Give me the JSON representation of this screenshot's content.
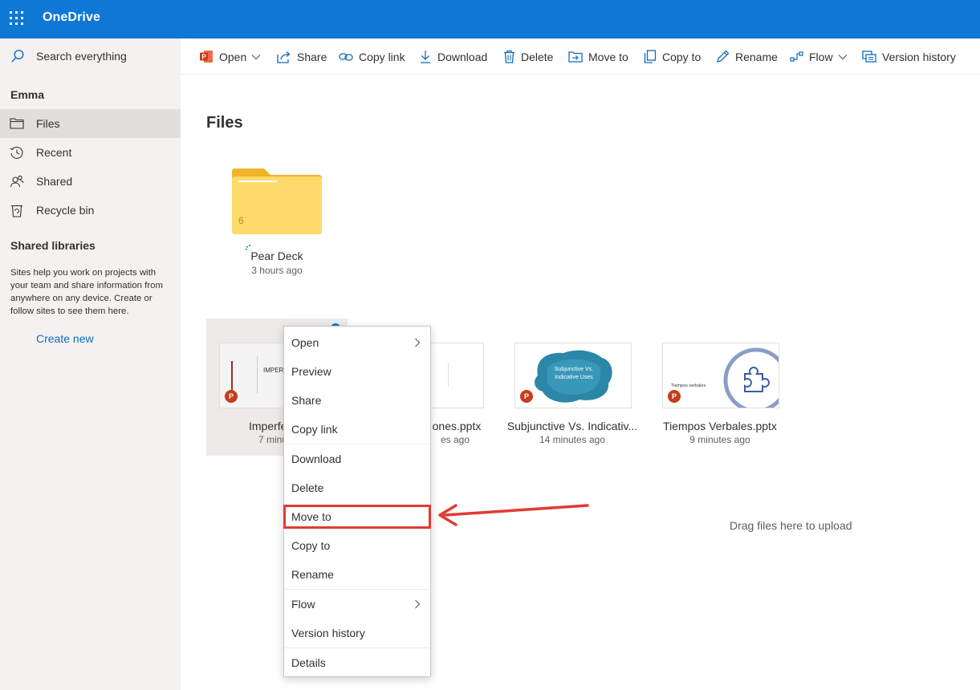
{
  "app": {
    "title": "OneDrive"
  },
  "search": {
    "placeholder": "Search everything"
  },
  "toolbar": {
    "open": "Open",
    "share": "Share",
    "copy_link": "Copy link",
    "download": "Download",
    "delete": "Delete",
    "move_to": "Move to",
    "copy_to": "Copy to",
    "rename": "Rename",
    "flow": "Flow",
    "version_history": "Version history"
  },
  "sidebar": {
    "user": "Emma",
    "items": [
      {
        "label": "Files",
        "icon": "folder-icon",
        "active": true
      },
      {
        "label": "Recent",
        "icon": "clock-icon"
      },
      {
        "label": "Shared",
        "icon": "people-icon"
      },
      {
        "label": "Recycle bin",
        "icon": "recycle-bin-icon"
      }
    ],
    "shared_libraries_title": "Shared libraries",
    "shared_libraries_desc": "Sites help you work on projects with your team and share information from anywhere on any device. Create or follow sites to see them here.",
    "create_new": "Create new"
  },
  "main": {
    "title": "Files",
    "folder": {
      "name": "Pear Deck",
      "modified": "3 hours ago",
      "count": "6"
    },
    "files": [
      {
        "name": "Imperfect u",
        "modified": "7 minute",
        "thumb_text": "IMPER TENS",
        "selected": true
      },
      {
        "name": "ones.pptx",
        "modified": "es ago"
      },
      {
        "name": "Subjunctive Vs. Indicativ...",
        "modified": "14 minutes ago",
        "thumb_text": "Subjunctive Vs. Indicative Uses"
      },
      {
        "name": "Tiempos Verbales.pptx",
        "modified": "9 minutes ago",
        "thumb_text": "Tiempos verbales"
      }
    ],
    "drag_hint": "Drag files here to upload"
  },
  "context_menu": {
    "items": [
      "Open",
      "Preview",
      "Share",
      "Copy link",
      "Download",
      "Delete",
      "Move to",
      "Copy to",
      "Rename",
      "Flow",
      "Version history",
      "Details"
    ],
    "highlighted": "Move to"
  },
  "colors": {
    "brand": "#0f78d4",
    "highlight": "#e03b32",
    "sidebar_bg": "#f3f2f1",
    "ppt": "#c43e1c"
  }
}
